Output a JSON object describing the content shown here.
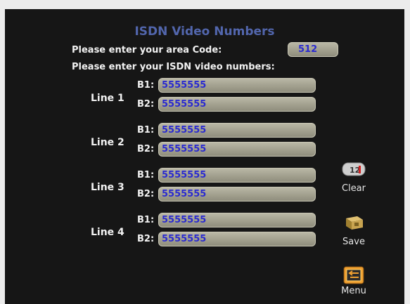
{
  "title": "ISDN Video Numbers",
  "prompts": {
    "area_code": "Please enter your area Code:",
    "numbers": "Please enter your ISDN video numbers:"
  },
  "area_code_value": "512",
  "b1_label": "B1:",
  "b2_label": "B2:",
  "lines": [
    {
      "label": "Line 1",
      "b1": "5555555",
      "b2": "5555555"
    },
    {
      "label": "Line 2",
      "b1": "5555555",
      "b2": "5555555"
    },
    {
      "label": "Line 3",
      "b1": "5555555",
      "b2": "5555555"
    },
    {
      "label": "Line 4",
      "b1": "5555555",
      "b2": "5555555"
    }
  ],
  "buttons": {
    "clear": {
      "label": "Clear",
      "icon": "clear-icon",
      "icon_text": "12"
    },
    "save": {
      "label": "Save",
      "icon": "save-box-icon"
    },
    "menu": {
      "label": "Menu",
      "icon": "back-arrow-icon"
    }
  },
  "colors": {
    "background": "#161616",
    "title": "#5266ad",
    "field": "#aeac9a",
    "field_text": "#2a2ad0",
    "menu_accent": "#f0a030"
  }
}
